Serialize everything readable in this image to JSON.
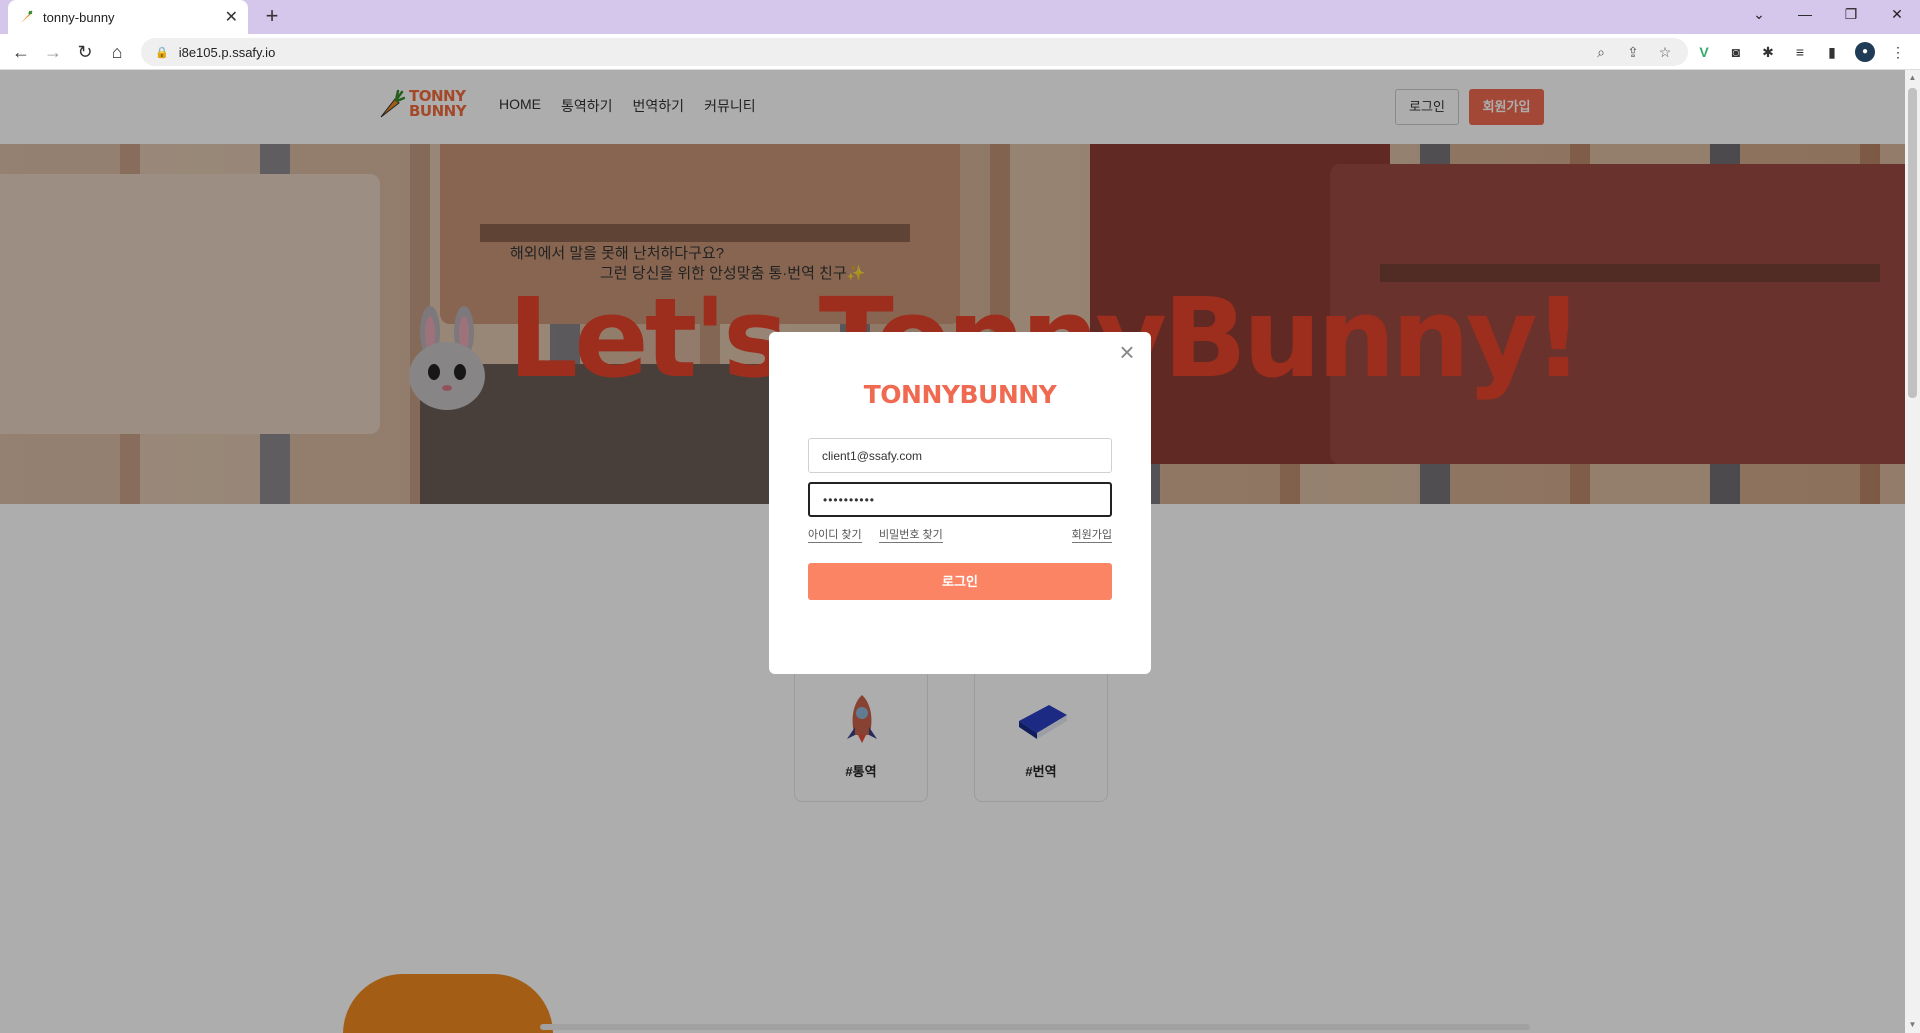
{
  "browser": {
    "tab_title": "tonny-bunny",
    "new_tab": "+",
    "url": "i8e105.p.ssafy.io"
  },
  "header": {
    "logo_line1": "TONNY",
    "logo_line2": "BUNNY",
    "nav": [
      "HOME",
      "통역하기",
      "번역하기",
      "커뮤니티"
    ],
    "login_label": "로그인",
    "signup_label": "회원가입"
  },
  "hero": {
    "subtitle_line1": "해외에서 말을 못해 난처하다구요?",
    "subtitle_line2": "그런 당신을 위한 안성맞춤 통·번역 친구✨",
    "title": "Let's TonnyBunny!"
  },
  "features": [
    {
      "label": "#통역",
      "icon": "rocket-icon"
    },
    {
      "label": "#번역",
      "icon": "book-icon"
    }
  ],
  "login_modal": {
    "logo": "TONNYBUNNY",
    "email_value": "client1@ssafy.com",
    "password_mask": "••••••••••",
    "find_id": "아이디 찾기",
    "find_password": "비밀번호 찾기",
    "signup": "회원가입",
    "login_button": "로그인"
  },
  "colors": {
    "brand": "#f06a52",
    "login_button": "#fb8464",
    "tab_strip": "#d5c6ec"
  }
}
